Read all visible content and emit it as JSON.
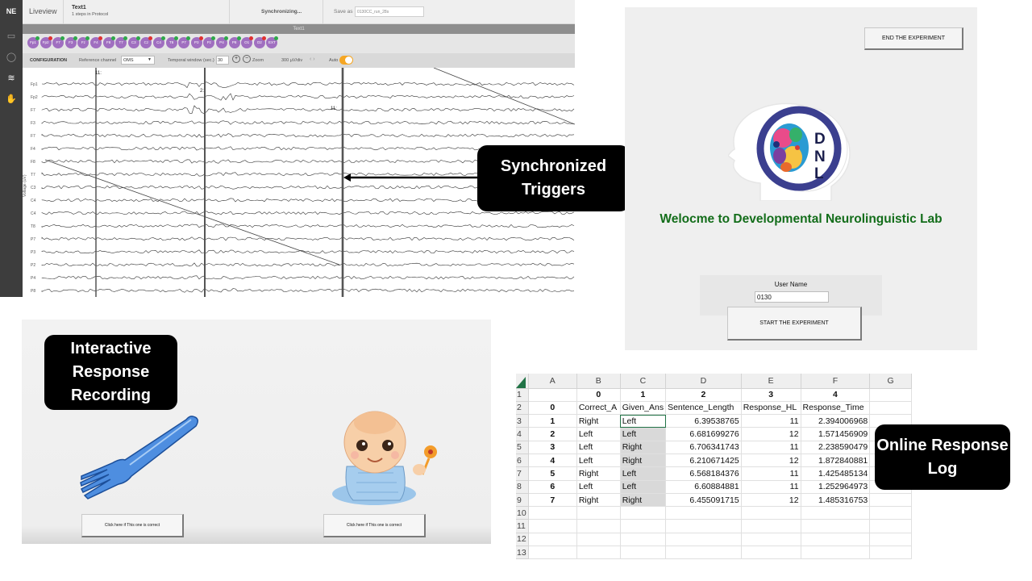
{
  "eeg": {
    "logo": "NE",
    "app_name": "Liveview",
    "protocol_name": "Text1",
    "protocol_steps": "1 steps in Protocol",
    "sync_status": "Synchronizing...",
    "save_as_label": "Save as",
    "save_as_value": "0130CC_run_28s",
    "strip_label": "Text1",
    "channel_buttons": [
      "Fp1",
      "Fp2",
      "F7",
      "F3",
      "Fz",
      "F4",
      "F8",
      "T7",
      "C3",
      "Cz",
      "C4",
      "T8",
      "P7",
      "P3",
      "Pz",
      "P4",
      "P8",
      "O1",
      "O2",
      "EXT"
    ],
    "config_label": "CONFIGURATION",
    "reference_label": "Reference channel",
    "reference_value": "OMS",
    "window_label": "Temporal window (sec.)",
    "window_value": "30",
    "zoom_label": "Zoom",
    "scale_value": "300 µV/div",
    "auto_label": "Auto",
    "y_axis_label": "Voltage (uV)",
    "channel_labels": [
      "Fp1",
      "Fp2",
      "F7",
      "F3",
      "F7",
      "F4",
      "F8",
      "T7",
      "C3",
      "C4",
      "C4",
      "T8",
      "P7",
      "P3",
      "P2",
      "P4",
      "P8"
    ],
    "markers": [
      "11:",
      "2:",
      "11:"
    ]
  },
  "callouts": {
    "sync": "Synchronized Triggers",
    "interactive": "Interactive Response Recording",
    "online": "Online Response Log"
  },
  "experiment": {
    "end_button": "END THE EXPERIMENT",
    "logo_letters": [
      "D",
      "N",
      "L"
    ],
    "logo_ring_text": "CALLIER CENTER FOR COMMUNICATION DISORDERS · THE UNIVERSITY OF TEXAS AT DALLAS",
    "logo_side_text": [
      "DEVELOPMENTAL",
      "NEUROLINGUISTICS",
      "LAB"
    ],
    "welcome": "Welocme to Developmental Neurolinguistic Lab",
    "user_label": "User Name",
    "user_value": "0130",
    "start_button": "START THE EXPERIMENT",
    "accent": "#136d1a"
  },
  "response": {
    "left_button": "Click here if This one is correct",
    "right_button": "Click here if This one is correct",
    "left_picture": "fork",
    "right_picture": "baby"
  },
  "sheet": {
    "columns": [
      "A",
      "B",
      "C",
      "D",
      "E",
      "F",
      "G"
    ],
    "row_numbers": [
      "1",
      "2",
      "3",
      "4",
      "5",
      "6",
      "7",
      "8",
      "9",
      "10",
      "11",
      "12",
      "13"
    ],
    "header_row": [
      "",
      "0",
      "1",
      "2",
      "3",
      "4",
      ""
    ],
    "field_row": [
      "0",
      "Correct_A",
      "Given_Ans",
      "Sentence_Length",
      "Response_HL",
      "Response_Time",
      ""
    ],
    "rows": [
      [
        "1",
        "Right",
        "Left",
        "6.39538765",
        "11",
        "2.394006968",
        ""
      ],
      [
        "2",
        "Left",
        "Left",
        "6.681699276",
        "12",
        "1.571456909",
        ""
      ],
      [
        "3",
        "Left",
        "Right",
        "6.706341743",
        "11",
        "2.238590479",
        ""
      ],
      [
        "4",
        "Left",
        "Right",
        "6.210671425",
        "12",
        "1.872840881",
        ""
      ],
      [
        "5",
        "Right",
        "Left",
        "6.568184376",
        "11",
        "1.425485134",
        ""
      ],
      [
        "6",
        "Left",
        "Left",
        "6.60884881",
        "11",
        "1.252964973",
        ""
      ],
      [
        "7",
        "Right",
        "Right",
        "6.455091715",
        "12",
        "1.485316753",
        ""
      ]
    ],
    "selected_column": "C",
    "corner_color": "#217346"
  }
}
